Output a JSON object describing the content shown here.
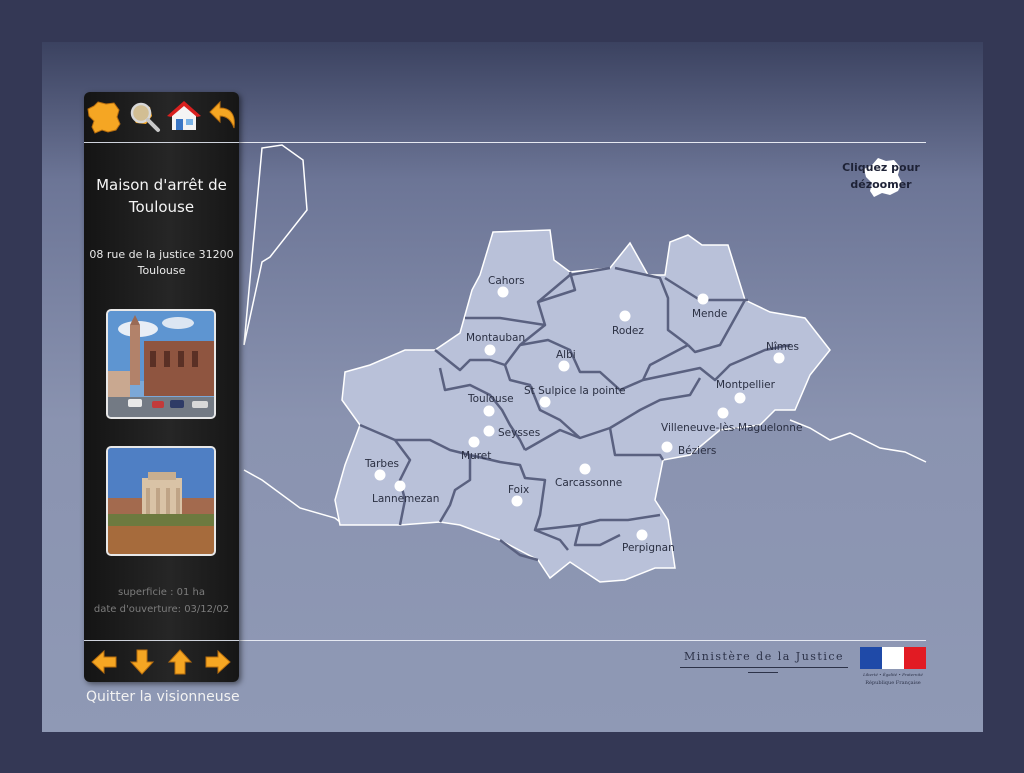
{
  "sidebar": {
    "toolbar": [
      {
        "name": "france-map-icon"
      },
      {
        "name": "zoom-search-icon"
      },
      {
        "name": "home-icon"
      },
      {
        "name": "back-icon"
      }
    ],
    "title": "Maison d'arrêt de Toulouse",
    "address": "08 rue de la justice 31200 Toulouse",
    "photos": [
      {
        "name": "photo-cathedral"
      },
      {
        "name": "photo-building"
      }
    ],
    "surface": "superficie : 01 ha",
    "opening_date": "date d'ouverture: 03/12/02",
    "nav": [
      {
        "name": "arrow-left-icon"
      },
      {
        "name": "arrow-down-icon"
      },
      {
        "name": "arrow-up-icon"
      },
      {
        "name": "arrow-right-icon"
      }
    ]
  },
  "quit_label": "Quitter la visionneuse",
  "dezoom_label_1": "Cliquez pour",
  "dezoom_label_2": "dézoomer",
  "map": {
    "cities": [
      {
        "name": "Cahors"
      },
      {
        "name": "Rodez"
      },
      {
        "name": "Mende"
      },
      {
        "name": "Montauban"
      },
      {
        "name": "Albi"
      },
      {
        "name": "Nîmes"
      },
      {
        "name": "St Sulpice la pointe"
      },
      {
        "name": "Toulouse"
      },
      {
        "name": "Montpellier"
      },
      {
        "name": "Seysses"
      },
      {
        "name": "Villeneuve-lès-Maguelonne"
      },
      {
        "name": "Muret"
      },
      {
        "name": "Béziers"
      },
      {
        "name": "Tarbes"
      },
      {
        "name": "Lannemezan"
      },
      {
        "name": "Foix"
      },
      {
        "name": "Carcassonne"
      },
      {
        "name": "Perpignan"
      }
    ]
  },
  "footer": {
    "ministry": "Ministère de la Justice",
    "motto": "Liberté • Égalité • Fraternité",
    "republic": "République Française"
  },
  "colors": {
    "region_fill": "#b8c0d8",
    "border": "#5d6480",
    "blue": "#1f4aa8",
    "red": "#e21b23",
    "icon_orange": "#f5a623"
  }
}
